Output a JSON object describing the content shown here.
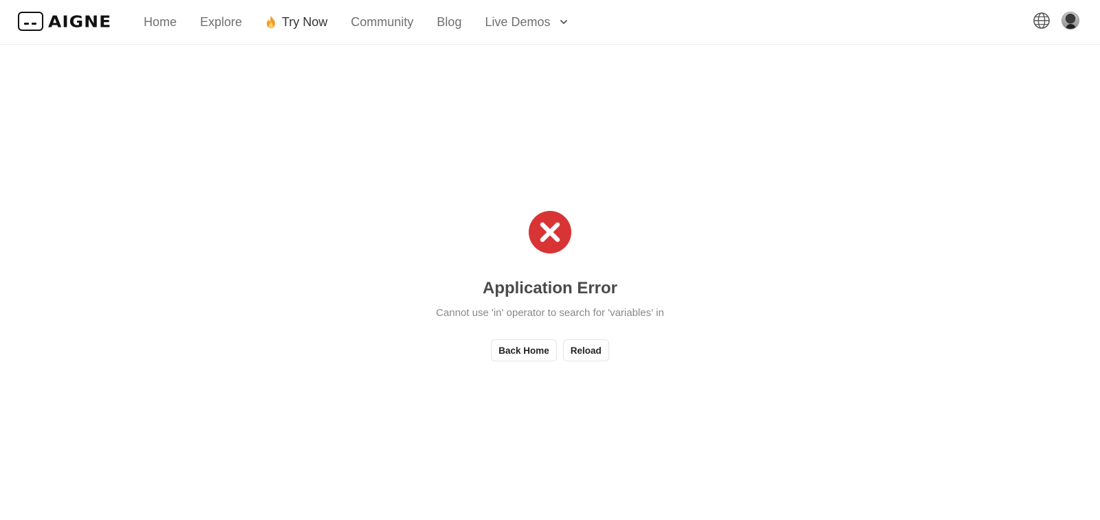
{
  "brand": {
    "name": "AIGNE",
    "logo_icon": "terminal-window-icon"
  },
  "nav": {
    "items": [
      {
        "label": "Home"
      },
      {
        "label": "Explore"
      },
      {
        "label": "Try Now",
        "icon": "fire-icon",
        "highlight": true
      },
      {
        "label": "Community"
      },
      {
        "label": "Blog"
      },
      {
        "label": "Live Demos",
        "icon": "chevron-down-icon"
      }
    ]
  },
  "toolbar": {
    "language_icon": "globe-icon",
    "avatar_icon": "user-avatar"
  },
  "error": {
    "icon": "error-x-icon",
    "title": "Application Error",
    "message": "Cannot use 'in' operator to search for 'variables' in",
    "back_home_label": "Back Home",
    "reload_label": "Reload"
  },
  "colors": {
    "error_red": "#d93435",
    "nav_text": "#6f6f6f",
    "border": "#ececec"
  }
}
